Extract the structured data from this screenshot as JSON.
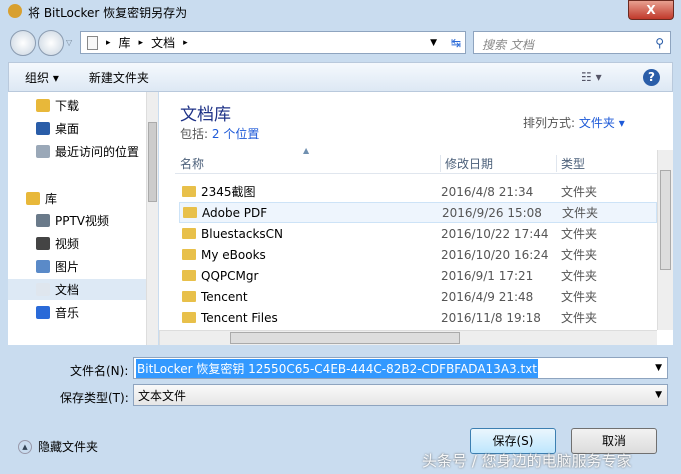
{
  "title": "将 BitLocker 恢复密钥另存为",
  "address": {
    "crumbs": [
      "库",
      "文档"
    ]
  },
  "search": {
    "placeholder": "搜索 文档"
  },
  "toolbar": {
    "organize": "组织 ▾",
    "new_folder": "新建文件夹"
  },
  "sidebar": {
    "items": [
      {
        "label": "下载",
        "icon": "download-folder-icon",
        "color": "#e8b83a"
      },
      {
        "label": "桌面",
        "icon": "desktop-icon",
        "color": "#2a5da8"
      },
      {
        "label": "最近访问的位置",
        "icon": "recent-places-icon",
        "color": "#9aa8b8"
      },
      {
        "label": "库",
        "icon": "library-icon",
        "color": "#e8b83a"
      },
      {
        "label": "PPTV视频",
        "icon": "video-library-icon",
        "color": "#6a7a8a"
      },
      {
        "label": "视频",
        "icon": "video-icon",
        "color": "#444"
      },
      {
        "label": "图片",
        "icon": "pictures-icon",
        "color": "#5a8ac8"
      },
      {
        "label": "文档",
        "icon": "documents-icon",
        "color": "#dfe6ee"
      },
      {
        "label": "音乐",
        "icon": "music-icon",
        "color": "#2a6ad8"
      }
    ]
  },
  "library": {
    "title": "文档库",
    "includes_label": "包括:",
    "includes_link": "2 个位置",
    "arrange_label": "排列方式:",
    "arrange_value": "文件夹 ▾"
  },
  "columns": [
    "名称",
    "修改日期",
    "类型"
  ],
  "files": [
    {
      "name": "2345截图",
      "date": "2016/4/8 21:34",
      "type": "文件夹"
    },
    {
      "name": "Adobe PDF",
      "date": "2016/9/26 15:08",
      "type": "文件夹"
    },
    {
      "name": "BluestacksCN",
      "date": "2016/10/22 17:44",
      "type": "文件夹"
    },
    {
      "name": "My eBooks",
      "date": "2016/10/20 16:24",
      "type": "文件夹"
    },
    {
      "name": "QQPCMgr",
      "date": "2016/9/1 17:21",
      "type": "文件夹"
    },
    {
      "name": "Tencent",
      "date": "2016/4/9 21:48",
      "type": "文件夹"
    },
    {
      "name": "Tencent Files",
      "date": "2016/11/8 19:18",
      "type": "文件夹"
    }
  ],
  "form": {
    "filename_label": "文件名(N):",
    "filename_value": "BitLocker 恢复密钥 12550C65-C4EB-444C-82B2-CDFBFADA13A3.txt",
    "type_label": "保存类型(T):",
    "type_value": "文本文件"
  },
  "footer": {
    "hide_folders": "隐藏文件夹",
    "save": "保存(S)",
    "cancel": "取消",
    "watermark": "头条号 / 您身边的电脑服务专家"
  }
}
